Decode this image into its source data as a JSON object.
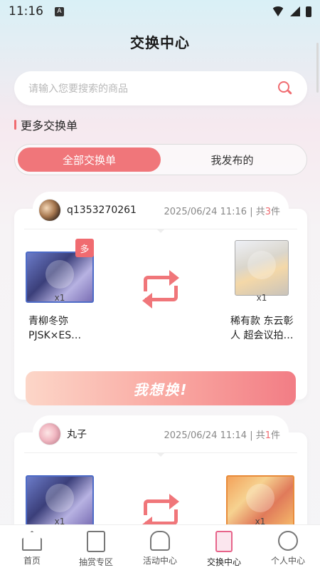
{
  "status": {
    "time": "11:16",
    "indicator": "A"
  },
  "header": {
    "title": "交换中心"
  },
  "search": {
    "placeholder": "请输入您要搜索的商品",
    "icon": "search-icon"
  },
  "section": {
    "title": "更多交换单"
  },
  "tabs": [
    {
      "label": "全部交换单",
      "active": true
    },
    {
      "label": "我发布的",
      "active": false
    }
  ],
  "cards": [
    {
      "username": "q1353270261",
      "datetime": "2025/06/24 11:16",
      "count_prefix": "| 共",
      "count": "3",
      "count_suffix": "件",
      "left_item": {
        "qty": "x1",
        "badge": "多",
        "name": "青柳冬弥 PJSK×ES…"
      },
      "right_item": {
        "qty": "x1",
        "name": "稀有款 东云彰人 超会议拍…"
      },
      "action": "我想换!"
    },
    {
      "username": "丸子",
      "datetime": "2025/06/24 11:14",
      "count_prefix": "| 共",
      "count": "1",
      "count_suffix": "件",
      "left_item": {
        "qty": "x1"
      },
      "right_item": {
        "qty": "x1"
      }
    }
  ],
  "bottom_nav": [
    {
      "label": "首页",
      "icon": "home-icon",
      "active": false
    },
    {
      "label": "抽赏专区",
      "icon": "draw-icon",
      "active": false
    },
    {
      "label": "活动中心",
      "icon": "activity-icon",
      "active": false
    },
    {
      "label": "交换中心",
      "icon": "exchange-icon",
      "active": true
    },
    {
      "label": "个人中心",
      "icon": "profile-icon",
      "active": false
    }
  ],
  "colors": {
    "accent": "#f06b70",
    "nav_active": "#e7648a"
  }
}
